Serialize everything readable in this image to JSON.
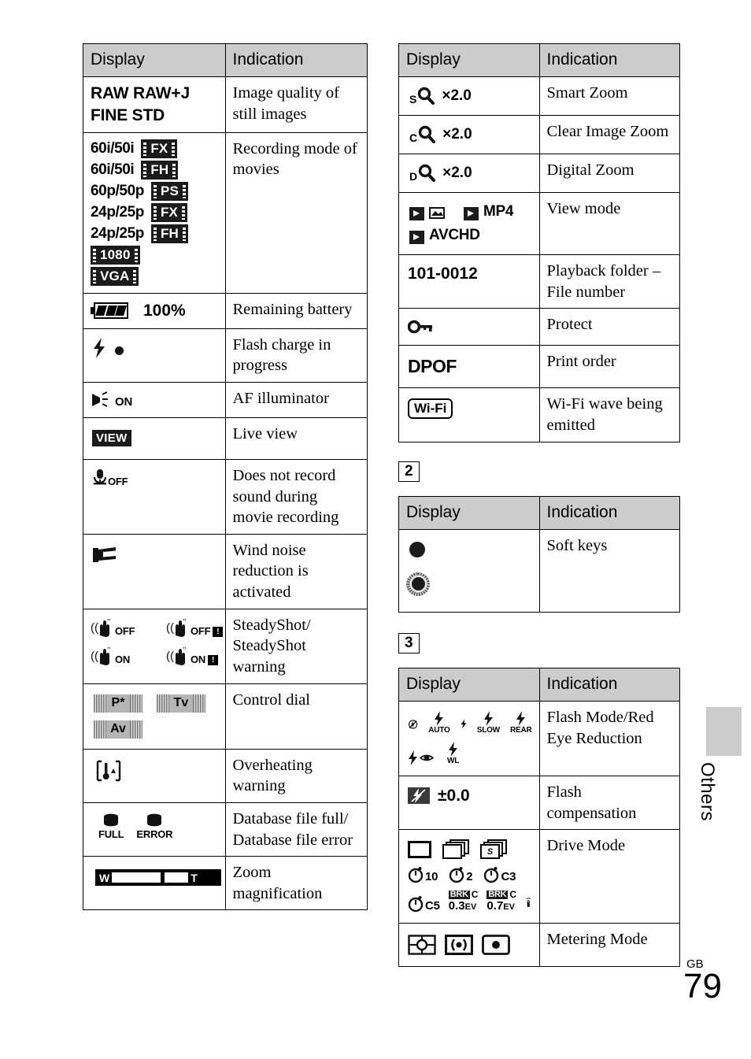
{
  "page": {
    "number": "79",
    "region_code": "GB",
    "side_tab_label": "Others"
  },
  "headers": {
    "display": "Display",
    "indication": "Indication"
  },
  "section_markers": {
    "two": "2",
    "three": "3"
  },
  "left_table": {
    "rows": [
      {
        "indication": "Image quality of still images",
        "display_text": [
          "RAW RAW+J",
          "FINE STD"
        ]
      },
      {
        "indication": "Recording mode of movies",
        "movie_modes": [
          {
            "rate": "60i/50i",
            "badge": "FX"
          },
          {
            "rate": "60i/50i",
            "badge": "FH"
          },
          {
            "rate": "60p/50p",
            "badge": "PS"
          },
          {
            "rate": "24p/25p",
            "badge": "FX"
          },
          {
            "rate": "24p/25p",
            "badge": "FH"
          },
          {
            "rate": "",
            "badge": "1080"
          },
          {
            "rate": "",
            "badge": "VGA"
          }
        ]
      },
      {
        "indication": "Remaining battery",
        "battery_percent": "100%"
      },
      {
        "indication": "Flash charge in progress"
      },
      {
        "indication": "AF illuminator",
        "af_label": "ON"
      },
      {
        "indication": "Live view",
        "view_badge": "VIEW"
      },
      {
        "indication": "Does not record sound during movie recording",
        "mic_label": "OFF"
      },
      {
        "indication": "Wind noise reduction is activated"
      },
      {
        "indication": "SteadyShot/ SteadyShot warning",
        "steadyshot": [
          "OFF",
          "OFF",
          "ON",
          "ON"
        ]
      },
      {
        "indication": "Control dial",
        "dials": [
          "P*",
          "Tv",
          "Av"
        ]
      },
      {
        "indication": "Overheating warning"
      },
      {
        "indication": "Database file full/ Database file error",
        "db_labels": [
          "FULL",
          "ERROR"
        ]
      },
      {
        "indication": "Zoom magnification",
        "zoom_wide": "W",
        "zoom_tele": "T"
      }
    ]
  },
  "right_table_1": {
    "rows": [
      {
        "indication": "Smart Zoom",
        "zoom_prefix": "S",
        "zoom_value": "×2.0"
      },
      {
        "indication": "Clear Image Zoom",
        "zoom_prefix": "C",
        "zoom_value": "×2.0"
      },
      {
        "indication": "Digital Zoom",
        "zoom_prefix": "D",
        "zoom_value": "×2.0"
      },
      {
        "indication": "View mode",
        "view_modes": [
          "MP4",
          "AVCHD"
        ]
      },
      {
        "indication": "Playback folder – File number",
        "folder_file": "101-0012"
      },
      {
        "indication": "Protect"
      },
      {
        "indication": "Print order",
        "dpof": "DPOF"
      },
      {
        "indication": "Wi-Fi wave being emitted",
        "wifi_badge": "Wi-Fi"
      }
    ]
  },
  "right_table_2": {
    "rows": [
      {
        "indication": "Soft keys"
      }
    ]
  },
  "right_table_3": {
    "rows": [
      {
        "indication": "Flash Mode/Red Eye Reduction",
        "flash_labels": [
          "AUTO",
          "SLOW",
          "REAR",
          "WL"
        ]
      },
      {
        "indication": "Flash compensation",
        "flash_comp_value": "±0.0"
      },
      {
        "indication": "Drive Mode",
        "timers": [
          "10",
          "2",
          "C3",
          "C5"
        ],
        "brackets": [
          {
            "box": "BRK",
            "c": "C",
            "ev": "0.3",
            "unit": "EV"
          },
          {
            "box": "BRK",
            "c": "C",
            "ev": "0.7",
            "unit": "EV"
          }
        ]
      },
      {
        "indication": "Metering Mode"
      }
    ]
  }
}
